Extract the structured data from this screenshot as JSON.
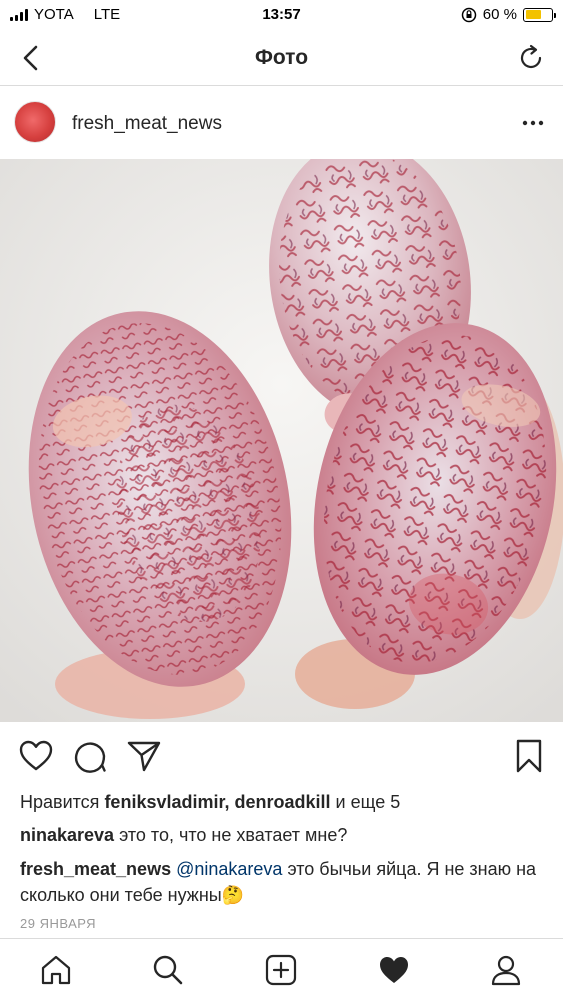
{
  "status_bar": {
    "carrier": "YOTA",
    "network": "LTE",
    "time": "13:57",
    "battery_percent": "60 %",
    "battery_level": 0.6,
    "icons": [
      "signal-icon",
      "orientation-lock-icon",
      "battery-icon"
    ]
  },
  "nav": {
    "title": "Фото",
    "icons": [
      "back-arrow-icon",
      "reload-icon"
    ]
  },
  "post": {
    "username": "fresh_meat_news",
    "image_alt": "три бычьих яйца на белой поверхности",
    "icons": [
      "more-options-icon",
      "heart-icon",
      "comment-icon",
      "share-icon",
      "bookmark-icon"
    ],
    "likes": {
      "prefix": "Нравится ",
      "users": "feniksvladimir, denroadkill",
      "suffix": " и еще 5"
    },
    "comments": [
      {
        "user": "ninakareva",
        "text": " это то, что не хватает мне?"
      },
      {
        "user": "fresh_meat_news",
        "mention": "@ninakareva",
        "text": " это бычьи яйца. Я не знаю на сколько они тебе нужны🤔"
      }
    ],
    "date": "29 ЯНВАРЯ"
  },
  "tabbar": {
    "icons": [
      "home-icon",
      "search-icon",
      "new-post-icon",
      "activity-heart-icon",
      "profile-icon"
    ]
  },
  "colors": {
    "text": "#262626",
    "mention": "#003569",
    "muted": "#999999",
    "divider": "#dbdbdb",
    "battery_fill": "#f3c200"
  }
}
